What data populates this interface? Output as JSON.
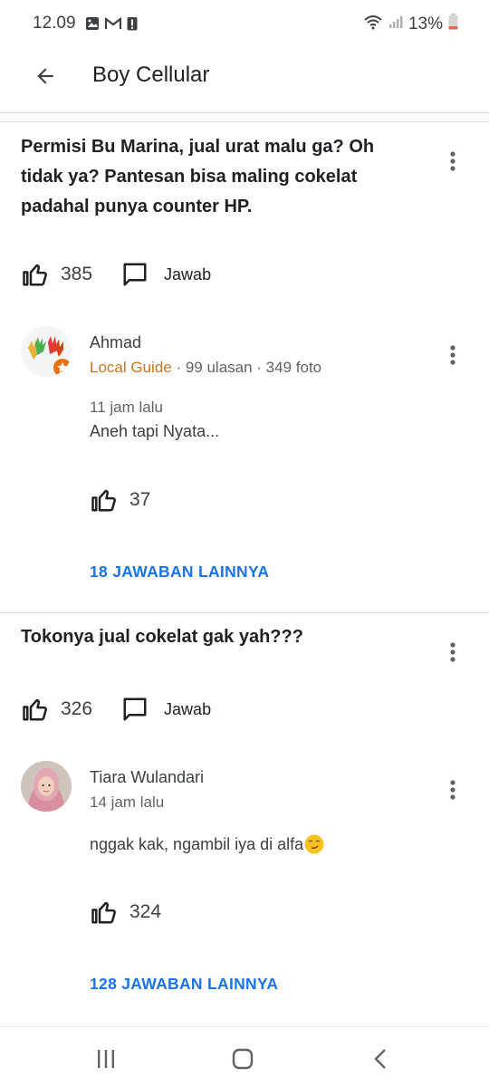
{
  "status_bar": {
    "time": "12.09",
    "battery": "13%",
    "icons": [
      "gallery-icon",
      "gmail-icon",
      "alert-icon",
      "wifi-icon",
      "signal-icon",
      "battery-icon"
    ]
  },
  "app_bar": {
    "title": "Boy Cellular",
    "back_icon": "arrow-back-icon"
  },
  "questions": [
    {
      "text": "Permisi Bu Marina, jual urat malu ga? Oh tidak ya? Pantesan bisa maling cokelat padahal punya counter HP.",
      "likes": "385",
      "reply_label": "Jawab",
      "answer": {
        "name": "Ahmad",
        "badge": "Local Guide",
        "stats": " · 99 ulasan · 349 foto",
        "time": "11 jam lalu",
        "text": "Aneh tapi Nyata...",
        "likes": "37"
      },
      "more_answers": "18 JAWABAN LAINNYA"
    },
    {
      "text": "Tokonya jual cokelat gak yah???",
      "likes": "326",
      "reply_label": "Jawab",
      "answer": {
        "name": "Tiara Wulandari",
        "time": "14 jam lalu",
        "text": "nggak kak, ngambil iya di alfa",
        "emoji": "😏",
        "likes": "324"
      },
      "more_answers": "128 JAWABAN LAINNYA"
    }
  ],
  "nav_bar": {
    "icons": [
      "recents-icon",
      "home-icon",
      "back-nav-icon"
    ]
  },
  "colors": {
    "accent": "#1a73e8",
    "local_guide": "#c5761f",
    "text_primary": "#202124",
    "text_secondary": "#5f6368"
  }
}
